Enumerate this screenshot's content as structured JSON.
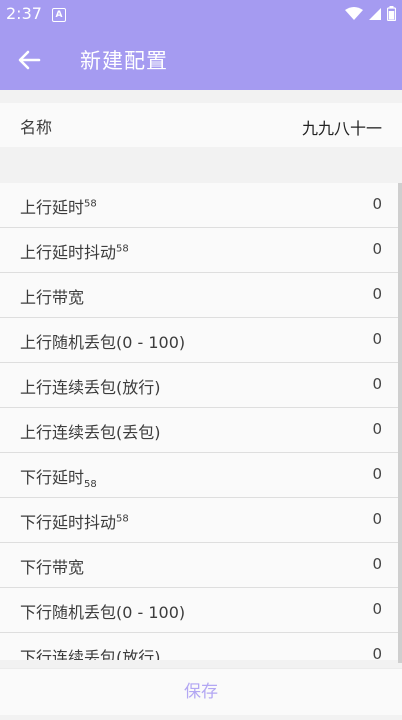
{
  "status": {
    "time": "2:37",
    "a_label": "A"
  },
  "header": {
    "title": "新建配置"
  },
  "name_row": {
    "label": "名称",
    "value": "九九八十一"
  },
  "rows": [
    {
      "label": "上行延时",
      "mark": "58",
      "mark_type": "sup",
      "value": "0"
    },
    {
      "label": "上行延时抖动",
      "mark": "58",
      "mark_type": "sup",
      "value": "0"
    },
    {
      "label": "上行带宽",
      "mark": "",
      "mark_type": "",
      "value": "0"
    },
    {
      "label": "上行随机丢包(0 - 100)",
      "mark": "",
      "mark_type": "",
      "value": "0"
    },
    {
      "label": "上行连续丢包(放行)",
      "mark": "",
      "mark_type": "",
      "value": "0"
    },
    {
      "label": "上行连续丢包(丢包)",
      "mark": "",
      "mark_type": "",
      "value": "0"
    },
    {
      "label": "下行延时",
      "mark": "58",
      "mark_type": "sub",
      "value": "0"
    },
    {
      "label": "下行延时抖动",
      "mark": "58",
      "mark_type": "sup",
      "value": "0"
    },
    {
      "label": "下行带宽",
      "mark": "",
      "mark_type": "",
      "value": "0"
    },
    {
      "label": "下行随机丢包(0 - 100)",
      "mark": "",
      "mark_type": "",
      "value": "0"
    },
    {
      "label": "下行连续丢包(放行)",
      "mark": "",
      "mark_type": "",
      "value": "0"
    }
  ],
  "footer": {
    "save_label": "保存"
  },
  "colors": {
    "primary": "#a59bf1",
    "save_text": "#b3a7f3"
  }
}
